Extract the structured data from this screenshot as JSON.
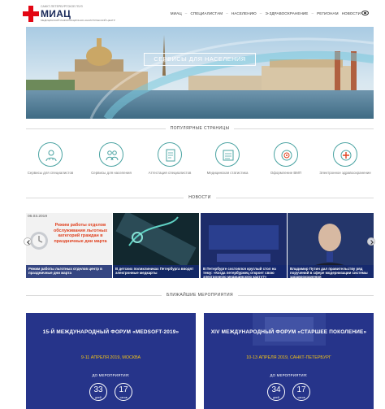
{
  "header": {
    "logo_pre": "САНКТ-ПЕТЕРБУРГСКОЕ ГБУЗ",
    "logo_name": "МИАЦ",
    "logo_sub": "МЕДИЦИНСКИЙ ИНФОРМАЦИОННО-АНАЛИТИЧЕСКИЙ ЦЕНТР",
    "nav": [
      "МИАЦ",
      "СПЕЦИАЛИСТАМ",
      "НАСЕЛЕНИЮ",
      "Э-ЗДРАВООХРАНЕНИЕ",
      "РЕГИОНАМ",
      "НОВОСТИ"
    ],
    "nav_sep": "–",
    "accessibility_icon": "eye-icon"
  },
  "hero": {
    "title": "СЕРВИСЫ ДЛЯ НАСЕЛЕНИЯ"
  },
  "popular": {
    "heading": "ПОПУЛЯРНЫЕ СТРАНИЦЫ",
    "items": [
      {
        "label": "Сервисы для специалистов",
        "icon": "doctor-icon"
      },
      {
        "label": "Сервисы для населения",
        "icon": "family-icon"
      },
      {
        "label": "Аттестация специалистов",
        "icon": "document-icon"
      },
      {
        "label": "Медицинская статистика",
        "icon": "chart-icon"
      },
      {
        "label": "Оформление ВМП",
        "icon": "target-icon"
      },
      {
        "label": "Электронное здравоохранение",
        "icon": "medical-plus-icon"
      }
    ],
    "accent_color": "#4aa3a2"
  },
  "news": {
    "heading": "НОВОСТИ",
    "featured_date": "06.03.2019",
    "featured_headline": "Режим работы отделов обслуживания льготных категорий граждан в праздничные дни марта",
    "items": [
      {
        "caption": "Режим работы льготных отделов центр в праздничные дни марта"
      },
      {
        "caption": "В детских поликлиниках Петербурга вводят электронные медкарты"
      },
      {
        "caption": "В Петербурге состоялся круглый стол на тему: «Когда петербуржец откроет свою электронную медицинскую карту?»"
      },
      {
        "caption": "Владимир Путин дал правительству ряд поручений в сфере модернизации системы здравоохранения"
      }
    ]
  },
  "events": {
    "heading": "БЛИЖАЙШИЕ МЕРОПРИЯТИЯ",
    "items": [
      {
        "title": "15-Й МЕЖДУНАРОДНЫЙ ФОРУМ «MEDSOFT-2019»",
        "date": "9-11 АПРЕЛЯ 2019, МОСКВА",
        "until": "ДО МЕРОПРИЯТИЯ:",
        "days": "33",
        "days_label": "дней",
        "hours": "17",
        "hours_label": "часов"
      },
      {
        "title": "XIV МЕЖДУНАРОДНЫЙ ФОРУМ «СТАРШЕЕ ПОКОЛЕНИЕ»",
        "date": "10-13 АПРЕЛЯ 2019, САНКТ-ПЕТЕРБУРГ",
        "until": "ДО МЕРОПРИЯТИЯ:",
        "days": "34",
        "days_label": "дней",
        "hours": "17",
        "hours_label": "часов"
      }
    ],
    "background_color": "#26348a",
    "date_color": "#f2c318"
  }
}
